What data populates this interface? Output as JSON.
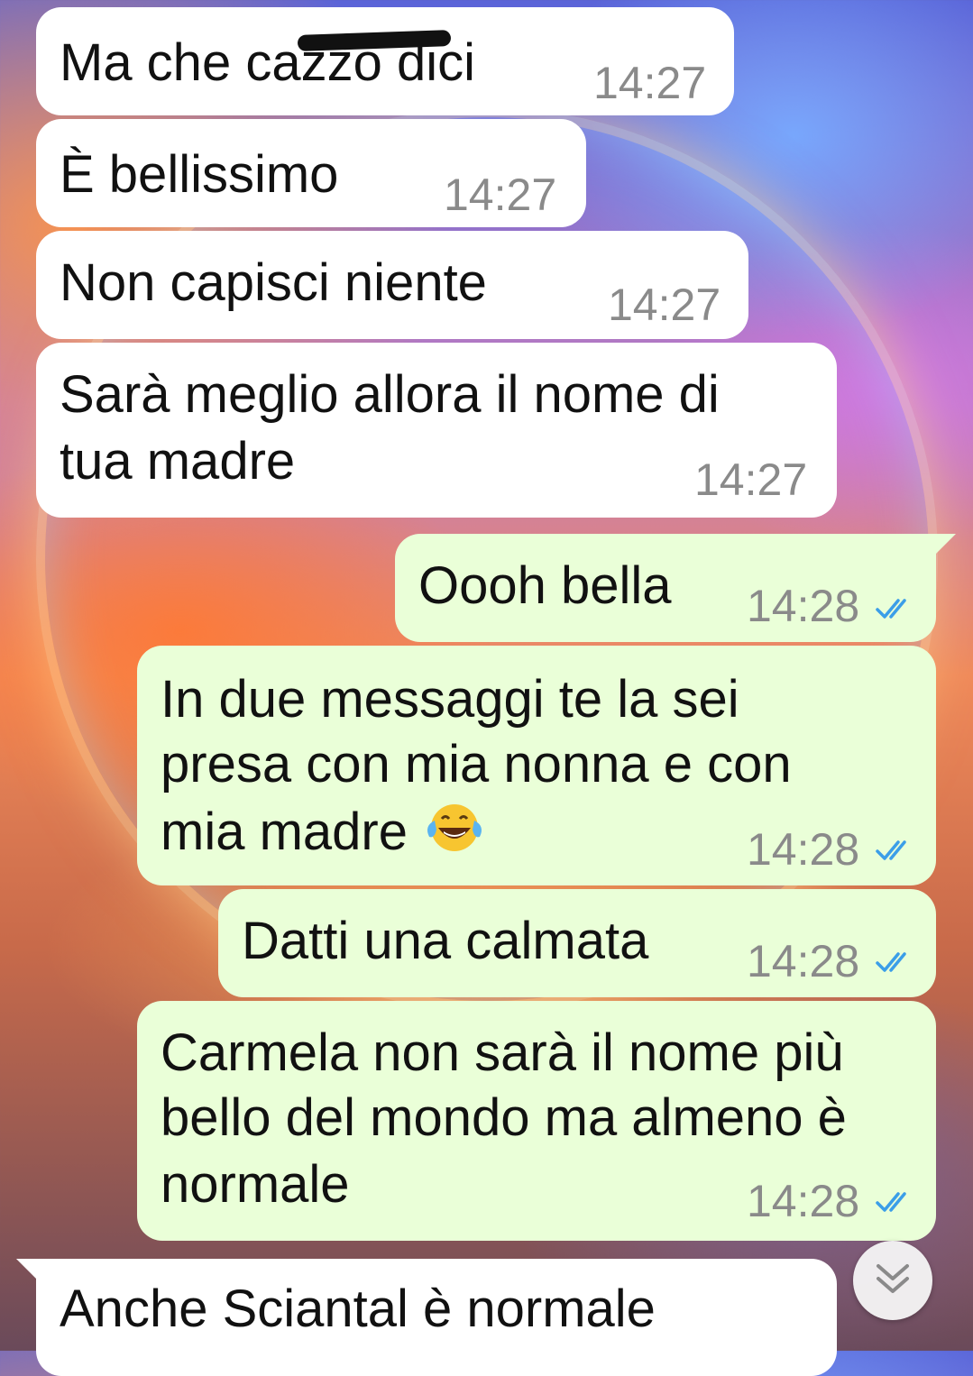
{
  "messages": [
    {
      "text_before": "Ma che ",
      "text_censored": "cazzo",
      "text_after": " dici",
      "time": "14:27",
      "direction": "incoming"
    },
    {
      "text": "È bellissimo",
      "time": "14:27",
      "direction": "incoming"
    },
    {
      "text": "Non capisci niente",
      "time": "14:27",
      "direction": "incoming"
    },
    {
      "line1": "Sarà meglio allora il nome di",
      "line2": "tua madre",
      "time": "14:27",
      "direction": "incoming"
    },
    {
      "text": "Oooh bella",
      "time": "14:28",
      "direction": "outgoing",
      "status": "read"
    },
    {
      "line1": "In due messaggi te la sei",
      "line2": "presa con mia nonna e con",
      "line3": "mia madre",
      "emoji": "face-with-tears-of-joy",
      "time": "14:28",
      "direction": "outgoing",
      "status": "read"
    },
    {
      "text": "Datti una calmata",
      "time": "14:28",
      "direction": "outgoing",
      "status": "read"
    },
    {
      "line1": "Carmela non sarà il nome più",
      "line2": "bello del mondo ma almeno è",
      "line3": "normale",
      "time": "14:28",
      "direction": "outgoing",
      "status": "read"
    },
    {
      "text": "Anche Sciantal è normale",
      "direction": "incoming"
    }
  ],
  "icons": {
    "read_ticks": "double-check-icon",
    "scroll_down": "chevron-double-down-icon"
  },
  "colors": {
    "incoming_bubble": "#ffffff",
    "outgoing_bubble": "#eaffd8",
    "read_tick": "#3b9ee8",
    "timestamp": "#8a8a8a"
  }
}
